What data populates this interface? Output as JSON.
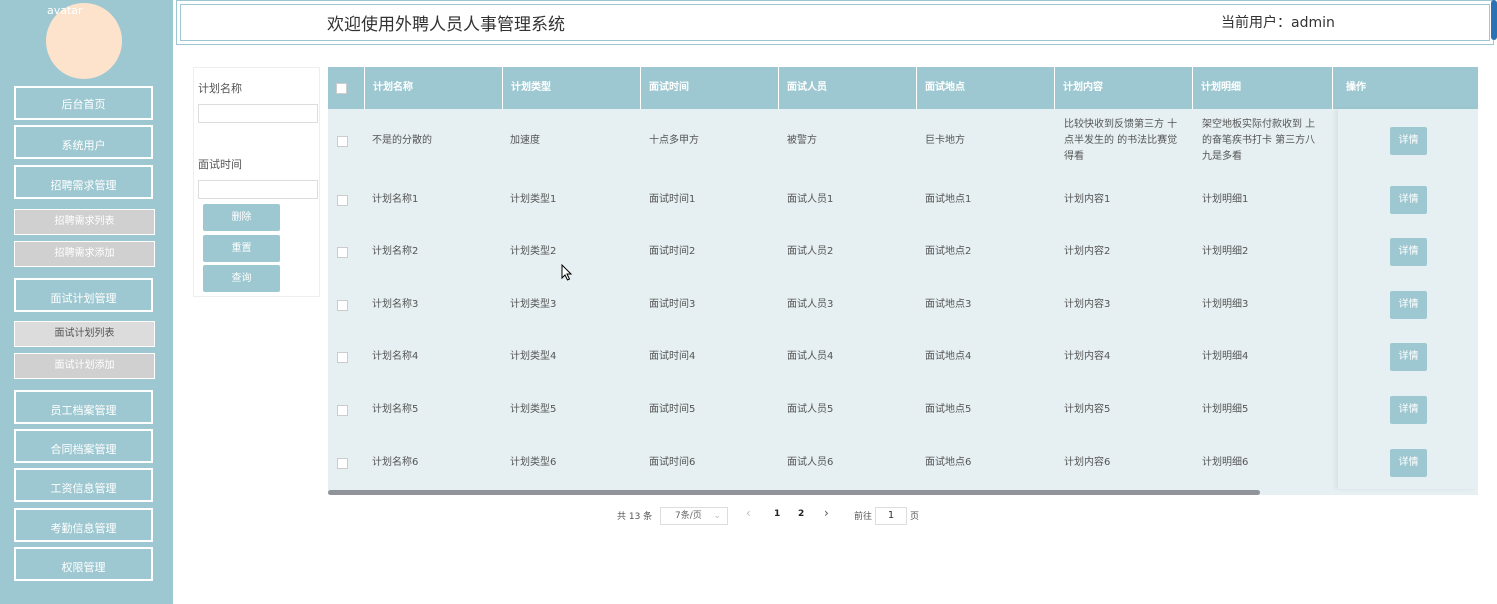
{
  "sidebar": {
    "avatar_alt": "avatar",
    "items": [
      {
        "label": "后台首页"
      },
      {
        "label": "系统用户"
      },
      {
        "label": "招聘需求管理"
      },
      {
        "label": "招聘需求列表"
      },
      {
        "label": "招聘需求添加"
      },
      {
        "label": "面试计划管理"
      },
      {
        "label": "面试计划列表"
      },
      {
        "label": "面试计划添加"
      },
      {
        "label": "员工档案管理"
      },
      {
        "label": "合同档案管理"
      },
      {
        "label": "工资信息管理"
      },
      {
        "label": "考勤信息管理"
      },
      {
        "label": "权限管理"
      }
    ]
  },
  "header": {
    "title": "欢迎使用外聘人员人事管理系统",
    "user": "当前用户：admin"
  },
  "search": {
    "plan_name_label": "计划名称",
    "interview_time_label": "面试时间",
    "delete_label": "删除",
    "reset_label": "重置",
    "query_label": "查询"
  },
  "table": {
    "headers": [
      "计划名称",
      "计划类型",
      "面试时间",
      "面试人员",
      "面试地点",
      "计划内容",
      "计划明细",
      "操作"
    ],
    "detail_label": "详情",
    "rows": [
      {
        "c": [
          "不是的分散的",
          "加速度",
          "十点多甲方",
          "被警方",
          "巨卡地方",
          "比较快收到反馈第三方 十点半发生的 的书法比赛觉得看",
          "架空地板实际付款收到 上的奋笔疾书打卡 第三方八九是多看"
        ]
      },
      {
        "c": [
          "计划名称1",
          "计划类型1",
          "面试时间1",
          "面试人员1",
          "面试地点1",
          "计划内容1",
          "计划明细1"
        ]
      },
      {
        "c": [
          "计划名称2",
          "计划类型2",
          "面试时间2",
          "面试人员2",
          "面试地点2",
          "计划内容2",
          "计划明细2"
        ]
      },
      {
        "c": [
          "计划名称3",
          "计划类型3",
          "面试时间3",
          "面试人员3",
          "面试地点3",
          "计划内容3",
          "计划明细3"
        ]
      },
      {
        "c": [
          "计划名称4",
          "计划类型4",
          "面试时间4",
          "面试人员4",
          "面试地点4",
          "计划内容4",
          "计划明细4"
        ]
      },
      {
        "c": [
          "计划名称5",
          "计划类型5",
          "面试时间5",
          "面试人员5",
          "面试地点5",
          "计划内容5",
          "计划明细5"
        ]
      },
      {
        "c": [
          "计划名称6",
          "计划类型6",
          "面试时间6",
          "面试人员6",
          "面试地点6",
          "计划内容6",
          "计划明细6"
        ]
      }
    ]
  },
  "pagination": {
    "total": "共 13 条",
    "page_size": "7条/页",
    "prev": "‹",
    "page1": "1",
    "page2": "2",
    "next": "›",
    "goto_label": "前往",
    "goto_value": "1",
    "page_suffix": "页"
  },
  "colors": {
    "accent": "#9ec8d1"
  }
}
